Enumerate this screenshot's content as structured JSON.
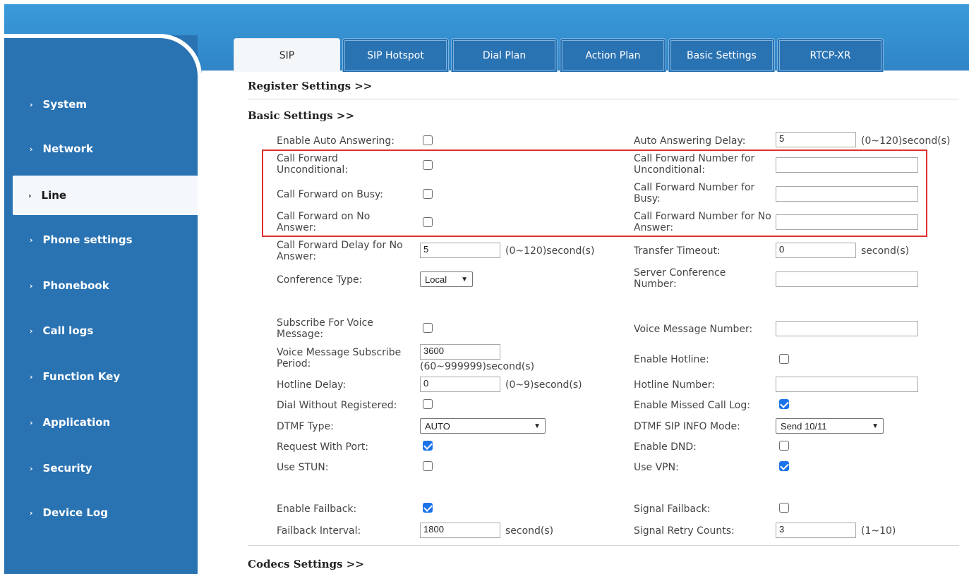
{
  "colors": {
    "sidebar": "#2a73b3",
    "highlight": "#e03030",
    "checkbox_on": "#1a73e8"
  },
  "nav": [
    {
      "label": "System"
    },
    {
      "label": "Network"
    },
    {
      "label": "Line"
    },
    {
      "label": "Phone settings"
    },
    {
      "label": "Phonebook"
    },
    {
      "label": "Call logs"
    },
    {
      "label": "Function Key"
    },
    {
      "label": "Application"
    },
    {
      "label": "Security"
    },
    {
      "label": "Device Log"
    }
  ],
  "tabs": [
    "SIP",
    "SIP Hotspot",
    "Dial Plan",
    "Action Plan",
    "Basic Settings",
    "RTCP-XR"
  ],
  "sections": {
    "register": "Register Settings >>",
    "basic": "Basic Settings >>",
    "codecs": "Codecs Settings >>"
  },
  "fields": {
    "enable_auto_answering": {
      "label": "Enable Auto Answering:",
      "checked": false
    },
    "auto_answering_delay": {
      "label": "Auto Answering Delay:",
      "value": "5",
      "unit": "(0~120)second(s)"
    },
    "cf_unconditional": {
      "label": "Call Forward Unconditional:",
      "checked": false
    },
    "cf_number_unconditional": {
      "label": "Call Forward Number for Unconditional:",
      "value": ""
    },
    "cf_busy": {
      "label": "Call Forward on Busy:",
      "checked": false
    },
    "cf_number_busy": {
      "label": "Call Forward Number for Busy:",
      "value": ""
    },
    "cf_no_answer": {
      "label": "Call Forward on No Answer:",
      "checked": false
    },
    "cf_number_no_answer": {
      "label": "Call Forward Number for No Answer:",
      "value": ""
    },
    "cf_delay": {
      "label": "Call Forward Delay for No Answer:",
      "value": "5",
      "unit": "(0~120)second(s)"
    },
    "transfer_timeout": {
      "label": "Transfer Timeout:",
      "value": "0",
      "unit": "second(s)"
    },
    "conference_type": {
      "label": "Conference Type:",
      "value": "Local"
    },
    "server_conference_number": {
      "label": "Server Conference Number:",
      "value": ""
    },
    "subscribe_voice_message": {
      "label": "Subscribe For Voice Message:",
      "checked": false
    },
    "voice_message_number": {
      "label": "Voice Message Number:",
      "value": ""
    },
    "vm_subscribe_period": {
      "label": "Voice Message Subscribe Period:",
      "value": "3600",
      "unit": "(60~999999)second(s)"
    },
    "enable_hotline": {
      "label": "Enable Hotline:",
      "checked": false
    },
    "hotline_delay": {
      "label": "Hotline Delay:",
      "value": "0",
      "unit": "(0~9)second(s)"
    },
    "hotline_number": {
      "label": "Hotline Number:",
      "value": ""
    },
    "dial_without_registered": {
      "label": "Dial Without Registered:",
      "checked": false
    },
    "enable_missed_call_log": {
      "label": "Enable Missed Call Log:",
      "checked": true
    },
    "dtmf_type": {
      "label": "DTMF Type:",
      "value": "AUTO"
    },
    "dtmf_sip_info_mode": {
      "label": "DTMF SIP INFO Mode:",
      "value": "Send 10/11"
    },
    "request_with_port": {
      "label": "Request With Port:",
      "checked": true
    },
    "enable_dnd": {
      "label": "Enable DND:",
      "checked": false
    },
    "use_stun": {
      "label": "Use STUN:",
      "checked": false
    },
    "use_vpn": {
      "label": "Use VPN:",
      "checked": true
    },
    "enable_failback": {
      "label": "Enable Failback:",
      "checked": true
    },
    "signal_failback": {
      "label": "Signal Failback:",
      "checked": false
    },
    "failback_interval": {
      "label": "Failback Interval:",
      "value": "1800",
      "unit": "second(s)"
    },
    "signal_retry_counts": {
      "label": "Signal Retry Counts:",
      "value": "3",
      "unit": "(1~10)"
    }
  }
}
